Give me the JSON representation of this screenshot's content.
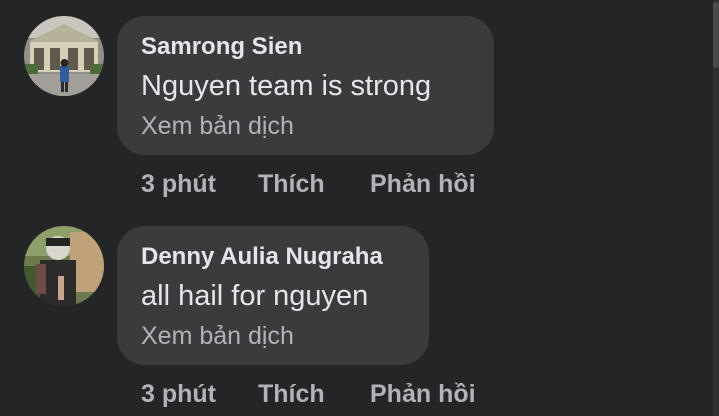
{
  "comments": [
    {
      "author": "Samrong Sien",
      "text": "Nguyen team is strong",
      "translate_label": "Xem bản dịch",
      "time": "3 phút",
      "like_label": "Thích",
      "reply_label": "Phản hồi"
    },
    {
      "author": "Denny Aulia Nugraha",
      "text": "all hail for nguyen",
      "translate_label": "Xem bản dịch",
      "time": "3 phút",
      "like_label": "Thích",
      "reply_label": "Phản hồi"
    }
  ]
}
